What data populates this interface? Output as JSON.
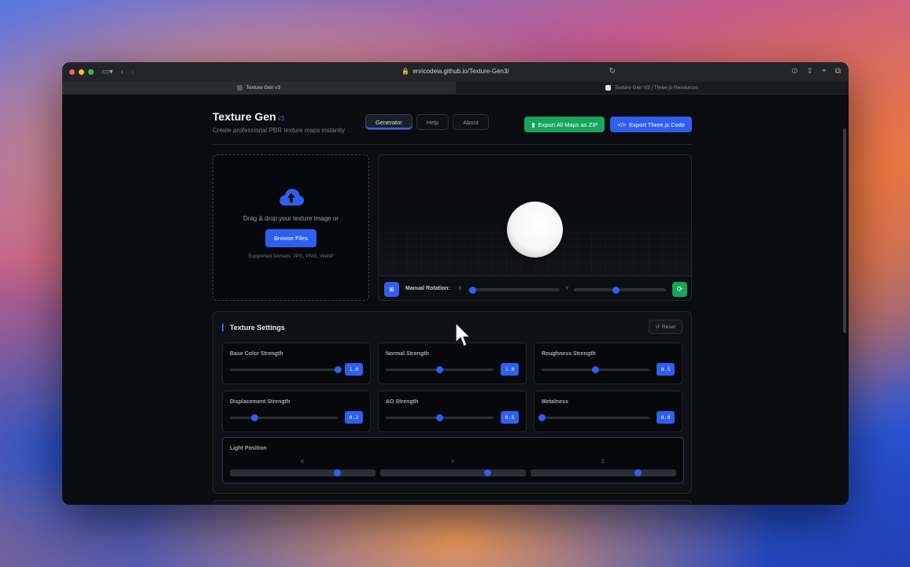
{
  "browser": {
    "url": "enricodeia.github.io/Texture-Gen3/",
    "tabs": [
      {
        "label": "Texture Gen v3",
        "active": true
      },
      {
        "label": "Texture Gen V3 | Three.js Resources",
        "active": false
      }
    ]
  },
  "header": {
    "title": "Texture Gen",
    "version": "v3",
    "subtitle": "Create professional PBR texture maps instantly",
    "nav": [
      "Generator",
      "Help",
      "About"
    ],
    "active_nav": "Generator",
    "export_zip": "Export All Maps as ZIP",
    "export_code": "Export Three.js Code"
  },
  "dropzone": {
    "text": "Drag & drop your texture image or",
    "button": "Browse Files",
    "formats": "Supported formats: JPG, PNG, WebP"
  },
  "preview": {
    "rotation_label": "Manual Rotation:",
    "x_label": "X",
    "y_label": "Y",
    "x_value": 0.05,
    "y_value": 0.46
  },
  "settings": {
    "title": "Texture Settings",
    "reset": "Reset",
    "sliders": [
      {
        "label": "Base Color Strength",
        "value": "1.0",
        "fraction": 1.0
      },
      {
        "label": "Normal Strength",
        "value": "1.0",
        "fraction": 0.5
      },
      {
        "label": "Roughness Strength",
        "value": "0.5",
        "fraction": 0.5
      },
      {
        "label": "Displacement Strength",
        "value": "0.2",
        "fraction": 0.23
      },
      {
        "label": "AO Strength",
        "value": "0.5",
        "fraction": 0.5
      },
      {
        "label": "Metalness",
        "value": "0.0",
        "fraction": 0.0
      }
    ],
    "light": {
      "label": "Light Position",
      "axes": [
        {
          "label": "X",
          "fraction": 0.74
        },
        {
          "label": "Y",
          "fraction": 0.74
        },
        {
          "label": "Z",
          "fraction": 0.74
        }
      ]
    }
  },
  "colors": {
    "accent": "#2e5ff0",
    "success": "#17a55a",
    "background": "#0b0c10"
  }
}
